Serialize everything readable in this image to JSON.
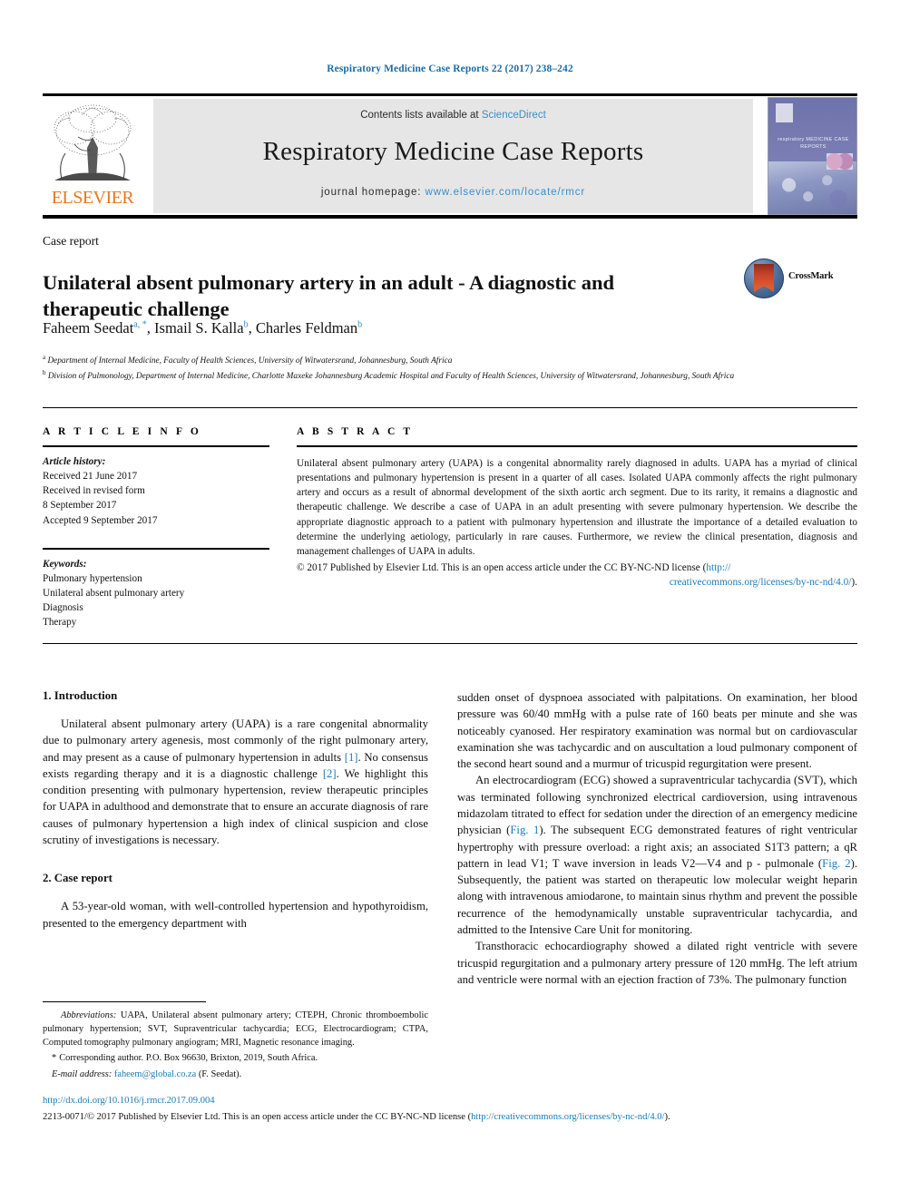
{
  "running_head": "Respiratory Medicine Case Reports 22 (2017) 238–242",
  "masthead": {
    "contents_prefix": "Contents lists available at ",
    "sciencedirect": "ScienceDirect",
    "journal_title": "Respiratory Medicine Case Reports",
    "homepage_prefix": "journal homepage: ",
    "homepage_url": "www.elsevier.com/locate/rmcr",
    "publisher": "ELSEVIER",
    "cover_title": "respiratory MEDICINE CASE REPORTS",
    "accent_blue": "#3a8ec8",
    "publisher_orange": "#e87722"
  },
  "article": {
    "type": "Case report",
    "title": "Unilateral absent pulmonary artery in an adult - A diagnostic and therapeutic challenge",
    "authors": "Faheem Seedat a, *, Ismail S. Kalla b, Charles Feldman b",
    "author_list": [
      {
        "name": "Faheem Seedat",
        "marks": "a, *"
      },
      {
        "name": "Ismail S. Kalla",
        "marks": "b"
      },
      {
        "name": "Charles Feldman",
        "marks": "b"
      }
    ],
    "affiliations": [
      {
        "mark": "a",
        "text": "Department of Internal Medicine, Faculty of Health Sciences, University of Witwatersrand, Johannesburg, South Africa"
      },
      {
        "mark": "b",
        "text": "Division of Pulmonology, Department of Internal Medicine, Charlotte Maxeke Johannesburg Academic Hospital and Faculty of Health Sciences, University of Witwatersrand, Johannesburg, South Africa"
      }
    ],
    "crossmark_label": "CrossMark"
  },
  "article_info": {
    "heading": "A R T I C L E   I N F O",
    "history_label": "Article history:",
    "history": [
      "Received 21 June 2017",
      "Received in revised form",
      "8 September 2017",
      "Accepted 9 September 2017"
    ],
    "keywords_label": "Keywords:",
    "keywords": [
      "Pulmonary hypertension",
      "Unilateral absent pulmonary artery",
      "Diagnosis",
      "Therapy"
    ]
  },
  "abstract": {
    "heading": "A B S T R A C T",
    "text": "Unilateral absent pulmonary artery (UAPA) is a congenital abnormality rarely diagnosed in adults. UAPA has a myriad of clinical presentations and pulmonary hypertension is present in a quarter of all cases. Isolated UAPA commonly affects the right pulmonary artery and occurs as a result of abnormal development of the sixth aortic arch segment. Due to its rarity, it remains a diagnostic and therapeutic challenge. We describe a case of UAPA in an adult presenting with severe pulmonary hypertension. We describe the appropriate diagnostic approach to a patient with pulmonary hypertension and illustrate the importance of a detailed evaluation to determine the underlying aetiology, particularly in rare causes. Furthermore, we review the clinical presentation, diagnosis and management challenges of UAPA in adults.",
    "copyright_prefix": "© 2017 Published by Elsevier Ltd. This is an open access article under the CC BY-NC-ND license (",
    "license_url_part1": "http://",
    "license_url_part2": "creativecommons.org/licenses/by-nc-nd/4.0/",
    "copyright_suffix": ")."
  },
  "sections": {
    "introduction": {
      "heading": "1. Introduction",
      "paragraph_part1": "Unilateral absent pulmonary artery (UAPA) is a rare congenital abnormality due to pulmonary artery agenesis, most commonly of the right pulmonary artery, and may present as a cause of pulmonary hypertension in adults ",
      "ref1": "[1]",
      "paragraph_part2": ". No consensus exists regarding therapy and it is a diagnostic challenge ",
      "ref2": "[2]",
      "paragraph_part3": ". We highlight this condition presenting with pulmonary hypertension, review therapeutic principles for UAPA in adulthood and demonstrate that to ensure an accurate diagnosis of rare causes of pulmonary hypertension a high index of clinical suspicion and close scrutiny of investigations is necessary."
    },
    "case_report": {
      "heading": "2. Case report",
      "paragraph1": "A 53-year-old woman, with well-controlled hypertension and hypothyroidism, presented to the emergency department with sudden onset of dyspnoea associated with palpitations. On examination, her blood pressure was 60/40 mmHg with a pulse rate of 160 beats per minute and she was noticeably cyanosed. Her respiratory examination was normal but on cardiovascular examination she was tachycardic and on auscultation a loud pulmonary component of the second heart sound and a murmur of tricuspid regurgitation were present.",
      "paragraph2_part1": "An electrocardiogram (ECG) showed a supraventricular tachycardia (SVT), which was terminated following synchronized electrical cardioversion, using intravenous midazolam titrated to effect for sedation under the direction of an emergency medicine physician (",
      "fig1": "Fig. 1",
      "paragraph2_part2": "). The subsequent ECG demonstrated features of right ventricular hypertrophy with pressure overload: a right axis; an associated S1T3 pattern; a qR pattern in lead V1; T wave inversion in leads V2—V4 and p - pulmonale (",
      "fig2": "Fig. 2",
      "paragraph2_part3": "). Subsequently, the patient was started on therapeutic low molecular weight heparin along with intravenous amiodarone, to maintain sinus rhythm and prevent the possible recurrence of the hemodynamically unstable supraventricular tachycardia, and admitted to the Intensive Care Unit for monitoring.",
      "paragraph3": "Transthoracic echocardiography showed a dilated right ventricle with severe tricuspid regurgitation and a pulmonary artery pressure of 120 mmHg. The left atrium and ventricle were normal with an ejection fraction of 73%. The pulmonary function"
    }
  },
  "footnotes": {
    "abbreviations_label": "Abbreviations:",
    "abbreviations_text": " UAPA, Unilateral absent pulmonary artery; CTEPH, Chronic thromboembolic pulmonary hypertension; SVT, Supraventricular tachycardia; ECG, Electrocardiogram; CTPA, Computed tomography pulmonary angiogram; MRI, Magnetic resonance imaging.",
    "corresponding_star": "*",
    "corresponding_text": "Corresponding author. P.O. Box 96630, Brixton, 2019, South Africa.",
    "email_label": "E-mail address:",
    "email": "faheem@global.co.za",
    "email_owner": "(F. Seedat)."
  },
  "legal": {
    "doi": "http://dx.doi.org/10.1016/j.rmcr.2017.09.004",
    "issn_prefix": "2213-0071/© 2017 Published by Elsevier Ltd. This is an open access article under the CC BY-NC-ND license (",
    "issn_license_url": "http://creativecommons.org/licenses/by-nc-nd/4.0/",
    "issn_suffix": ")."
  }
}
